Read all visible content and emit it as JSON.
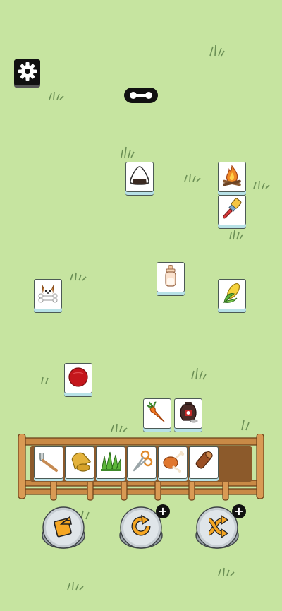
{
  "settings": {
    "icon": "gear-icon"
  },
  "header": {
    "indicator_icon": "link-pill-icon"
  },
  "board_tiles": [
    {
      "item": "rice-ball-icon"
    },
    {
      "item": "campfire-icon"
    },
    {
      "item": "paint-brush-icon"
    },
    {
      "item": "baby-bottle-icon"
    },
    {
      "item": "corgi-bone-icon"
    },
    {
      "item": "corn-icon"
    },
    {
      "item": "red-ball-icon"
    },
    {
      "item": "carrot-icon"
    },
    {
      "item": "vase-icon"
    }
  ],
  "tray": {
    "slots_total": 7,
    "items": [
      "fork-icon",
      "bell-icon",
      "grass-tuft-icon",
      "scissors-icon",
      "roast-chicken-icon",
      "log-icon"
    ]
  },
  "toolbar": {
    "buttons": [
      {
        "name": "undo-card-button",
        "icon": "card-undo-icon",
        "has_plus": false
      },
      {
        "name": "refresh-button",
        "icon": "refresh-icon",
        "has_plus": true,
        "plus_label": "+"
      },
      {
        "name": "shuffle-button",
        "icon": "shuffle-icon",
        "has_plus": true,
        "plus_label": "+"
      }
    ]
  }
}
